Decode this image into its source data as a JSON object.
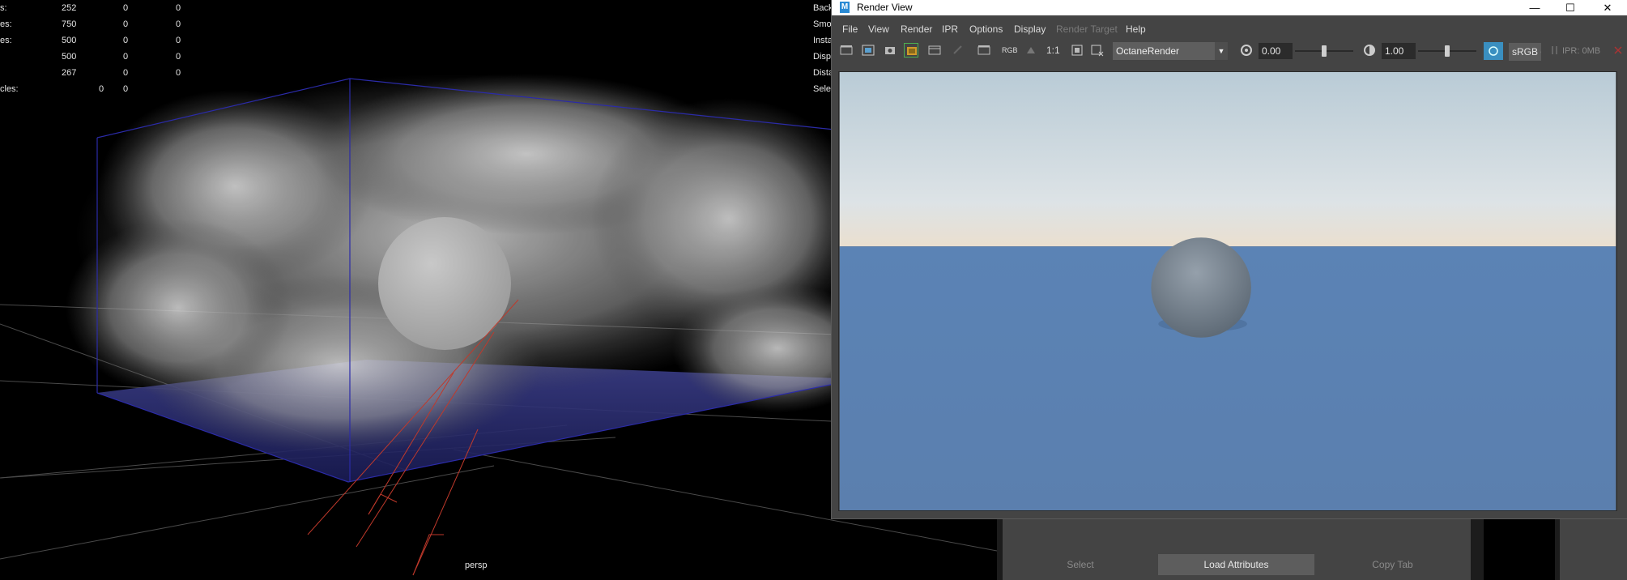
{
  "viewport": {
    "hud_rows": [
      {
        "label": "s:",
        "v1": "252",
        "v2": "0",
        "v3": "0"
      },
      {
        "label": "es:",
        "v1": "750",
        "v2": "0",
        "v3": "0"
      },
      {
        "label": "es:",
        "v1": "500",
        "v2": "0",
        "v3": "0"
      },
      {
        "label": "",
        "v1": "500",
        "v2": "0",
        "v3": "0"
      },
      {
        "label": "",
        "v1": "267",
        "v2": "0",
        "v3": "0"
      }
    ],
    "hud_particles": {
      "label": "cles:",
      "v1": "0",
      "v2": "0"
    },
    "hud_right": [
      "Back",
      "Smo",
      "Insta",
      "Disp",
      "Dista",
      "Sele"
    ],
    "camera_label": "persp"
  },
  "render_view": {
    "title": "Render View",
    "logo": "M",
    "window_buttons": {
      "minimize": "—",
      "maximize": "☐",
      "close": "✕"
    },
    "menu": [
      "File",
      "View",
      "Render",
      "IPR",
      "Options",
      "Display",
      "Render Target",
      "Help"
    ],
    "toolbar": {
      "rgb_label": "RGB",
      "ratio_label": "1:1",
      "renderer": "OctaneRender",
      "exposure": "0.00",
      "gamma": "1.00",
      "exposure_slider": 0.5,
      "gamma_slider": 0.5,
      "colorspace": "sRGB g",
      "ipr_memory": "IPR: 0MB"
    },
    "colors": {
      "sky_top": "#b9cbd6",
      "horizon": "#eadfcf",
      "ground": "#5b7fae",
      "accent": "#3a8fc0"
    }
  },
  "attribute_editor": {
    "buttons": [
      "Select",
      "Load Attributes",
      "Copy Tab"
    ]
  }
}
